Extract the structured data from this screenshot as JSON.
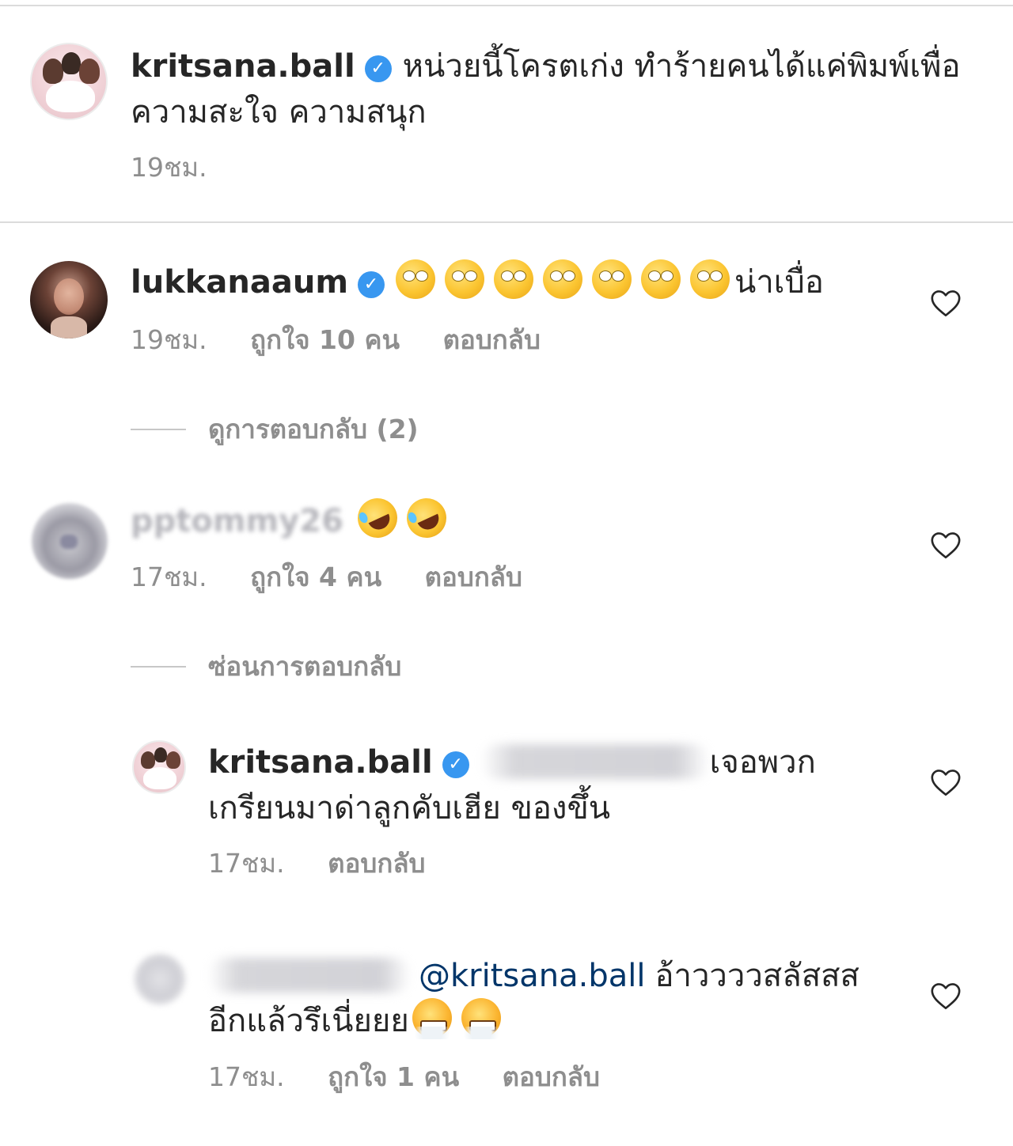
{
  "caption": {
    "username": "kritsana.ball",
    "text_line1": "หน่วยนี้โครตเก่ง ทำร้ายคนได้แค่พิมพ์เพื่อ",
    "text_line2": "ความสะใจ ความสนุก",
    "timestamp": "19ชม."
  },
  "comments": [
    {
      "username": "lukkanaaum",
      "verified": true,
      "emoji": "face-with-rolling-eyes x7",
      "text": "น่าเบื่อ",
      "timestamp": "19ชม.",
      "likes": "ถูกใจ 10 คน",
      "reply": "ตอบกลับ"
    },
    {
      "username": "pptommy26",
      "emoji": "rolling-on-the-floor-laughing x2",
      "timestamp": "17ชม.",
      "likes": "ถูกใจ 4 คน",
      "reply": "ตอบกลับ"
    }
  ],
  "thread_toggles": {
    "view_replies": "ดูการตอบกลับ (2)",
    "hide_replies": "ซ่อนการตอบกลับ"
  },
  "replies": [
    {
      "username": "kritsana.ball",
      "verified": true,
      "text_line1": "เจอพวก",
      "text_line2": "เกรียนมาด่าลูกคับเฮีย ของขึ้น",
      "timestamp": "17ชม.",
      "reply": "ตอบกลับ"
    },
    {
      "mention": "@kritsana.ball",
      "text_line1": "อ้าววววสลัสสส",
      "text_line2": "อีกแล้วรึเนี่ยยย",
      "emoji": "face-with-steam-from-nose x2",
      "timestamp": "17ชม.",
      "likes": "ถูกใจ 1 คน",
      "reply": "ตอบกลับ"
    }
  ],
  "icons": {
    "verified": "verified-badge-icon",
    "heart": "heart-outline-icon"
  },
  "colors": {
    "text": "#262626",
    "meta": "#8e8e8e",
    "verified": "#3897f0",
    "mention": "#003569",
    "divider": "#dbdbdb"
  }
}
